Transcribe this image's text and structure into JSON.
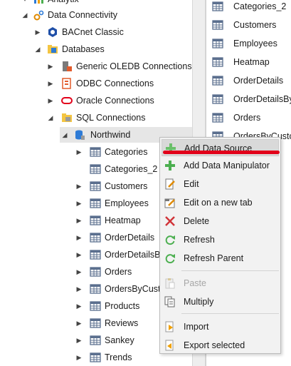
{
  "tree": {
    "items": [
      {
        "label": "Analytix",
        "toggle": "▾",
        "icon": "analytix-icon"
      },
      {
        "label": "Data Connectivity",
        "toggle": "◢",
        "icon": "gear-icon"
      },
      {
        "label": "BACnet Classic",
        "toggle": "▶",
        "icon": "bacnet-icon"
      },
      {
        "label": "Databases",
        "toggle": "◢",
        "icon": "databases-icon"
      },
      {
        "label": "Generic OLEDB Connections",
        "toggle": "▶",
        "icon": "oledb-icon"
      },
      {
        "label": "ODBC Connections",
        "toggle": "▶",
        "icon": "odbc-icon"
      },
      {
        "label": "Oracle Connections",
        "toggle": "▶",
        "icon": "oracle-icon"
      },
      {
        "label": "SQL Connections",
        "toggle": "◢",
        "icon": "sql-folder-icon"
      },
      {
        "label": "Northwind",
        "toggle": "◢",
        "icon": "database-icon"
      },
      {
        "label": "Categories",
        "toggle": "▶",
        "icon": "table-icon"
      },
      {
        "label": "Categories_2",
        "toggle": "",
        "icon": "table-icon"
      },
      {
        "label": "Customers",
        "toggle": "▶",
        "icon": "table-icon"
      },
      {
        "label": "Employees",
        "toggle": "▶",
        "icon": "table-icon"
      },
      {
        "label": "Heatmap",
        "toggle": "▶",
        "icon": "table-icon"
      },
      {
        "label": "OrderDetails",
        "toggle": "▶",
        "icon": "table-icon"
      },
      {
        "label": "OrderDetailsBy",
        "toggle": "▶",
        "icon": "table-icon"
      },
      {
        "label": "Orders",
        "toggle": "▶",
        "icon": "table-icon"
      },
      {
        "label": "OrdersByCusto",
        "toggle": "▶",
        "icon": "table-icon"
      },
      {
        "label": "Products",
        "toggle": "▶",
        "icon": "table-icon"
      },
      {
        "label": "Reviews",
        "toggle": "▶",
        "icon": "table-icon"
      },
      {
        "label": "Sankey",
        "toggle": "▶",
        "icon": "table-icon"
      },
      {
        "label": "Trends",
        "toggle": "▶",
        "icon": "table-icon"
      }
    ]
  },
  "right_list": {
    "items": [
      "Categories_2",
      "Customers",
      "Employees",
      "Heatmap",
      "OrderDetails",
      "OrderDetailsByC",
      "Orders",
      "OrdersByCusto"
    ]
  },
  "context_menu": {
    "add_data_source": "Add Data Source",
    "add_data_manipulator": "Add Data Manipulator",
    "edit": "Edit",
    "edit_new_tab": "Edit on a new tab",
    "delete": "Delete",
    "refresh": "Refresh",
    "refresh_parent": "Refresh Parent",
    "paste": "Paste",
    "multiply": "Multiply",
    "import": "Import",
    "export_selected": "Export selected"
  },
  "colors": {
    "selection": "#e6e6e6",
    "menu_highlight": "#d9d9d9",
    "annotation_red": "#e2001a",
    "table_icon": "#5b6f8e",
    "add_icon": "#4caf50",
    "delete_icon": "#d13438"
  }
}
